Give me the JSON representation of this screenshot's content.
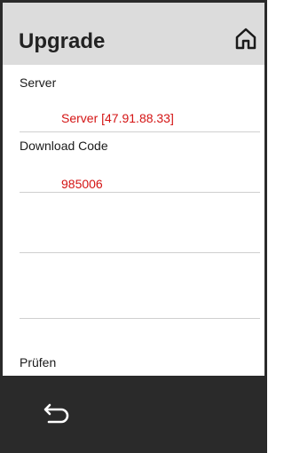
{
  "header": {
    "title": "Upgrade",
    "home_icon": "home-icon"
  },
  "fields": {
    "server": {
      "label": "Server",
      "value": "Server [47.91.88.33]"
    },
    "download_code": {
      "label": "Download Code",
      "value": "985006"
    },
    "check": {
      "label": "Prüfen"
    }
  },
  "footer": {
    "back_icon": "back-arrow-icon"
  },
  "colors": {
    "header_bg": "#dcdcdc",
    "footer_bg": "#2a2a2a",
    "value_text": "#d41414",
    "divider": "#cfcfcf"
  }
}
